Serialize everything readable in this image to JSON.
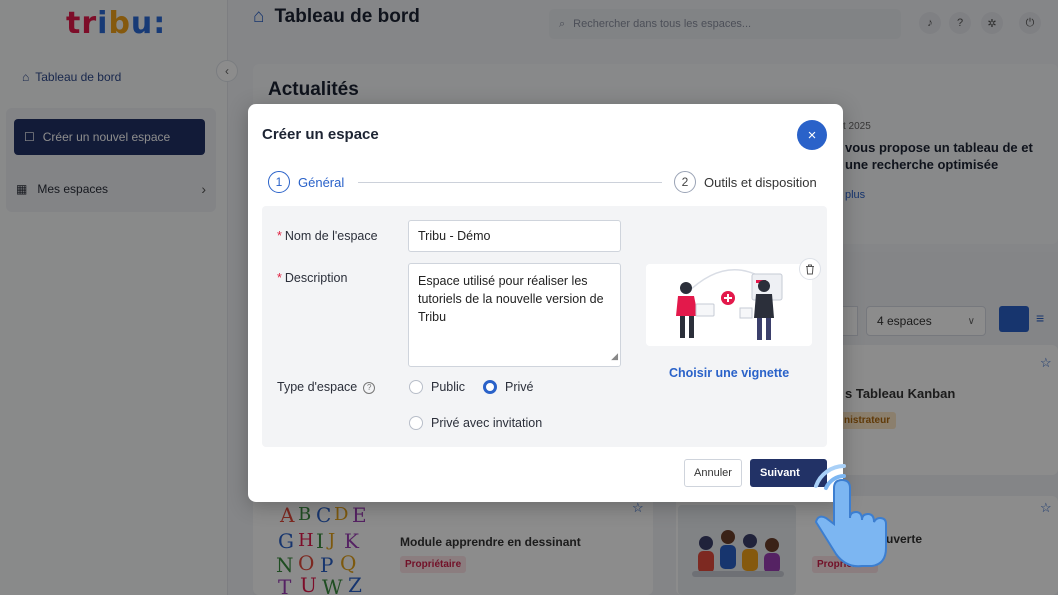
{
  "app": {
    "logo_text": "tribu:",
    "page_title": "Tableau de bord",
    "search_placeholder": "Rechercher dans tous les espaces..."
  },
  "sidebar": {
    "dashboard_label": "Tableau de bord",
    "create_space_label": "Créer un nouvel espace",
    "my_spaces_label": "Mes espaces"
  },
  "news": {
    "title": "Actualités",
    "date_fragment": "t 2025",
    "headline": "vous propose un tableau de et une recherche optimisée",
    "more_fragment": "plus"
  },
  "spaces": {
    "count_label": "4 espaces",
    "card_right_title": "s Tableau Kanban",
    "card_right_badge": "nistrateur",
    "card_bottom_left_title": "Module apprendre en dessinant",
    "card_bottom_left_badge": "Propriétaire",
    "card_bottom_right_title": "découverte",
    "card_bottom_right_badge": "Propriétaire"
  },
  "modal": {
    "title": "Créer un espace",
    "close_icon": "×",
    "steps": [
      {
        "num": "1",
        "label": "Général"
      },
      {
        "num": "2",
        "label": "Outils et disposition"
      }
    ],
    "fields": {
      "name_label": "Nom de l'espace",
      "name_value": "Tribu - Démo",
      "description_label": "Description",
      "description_value": "Espace utilisé pour réaliser les tutoriels de la nouvelle version de Tribu",
      "type_label": "Type d'espace",
      "type_options": [
        "Public",
        "Privé",
        "Privé avec invitation"
      ],
      "type_selected": "Privé"
    },
    "thumbnail_link": "Choisir une vignette",
    "cancel_label": "Annuler",
    "next_label": "Suivant"
  },
  "colors": {
    "primary": "#2a62c9",
    "dark_button": "#223266",
    "required": "#e02040"
  }
}
